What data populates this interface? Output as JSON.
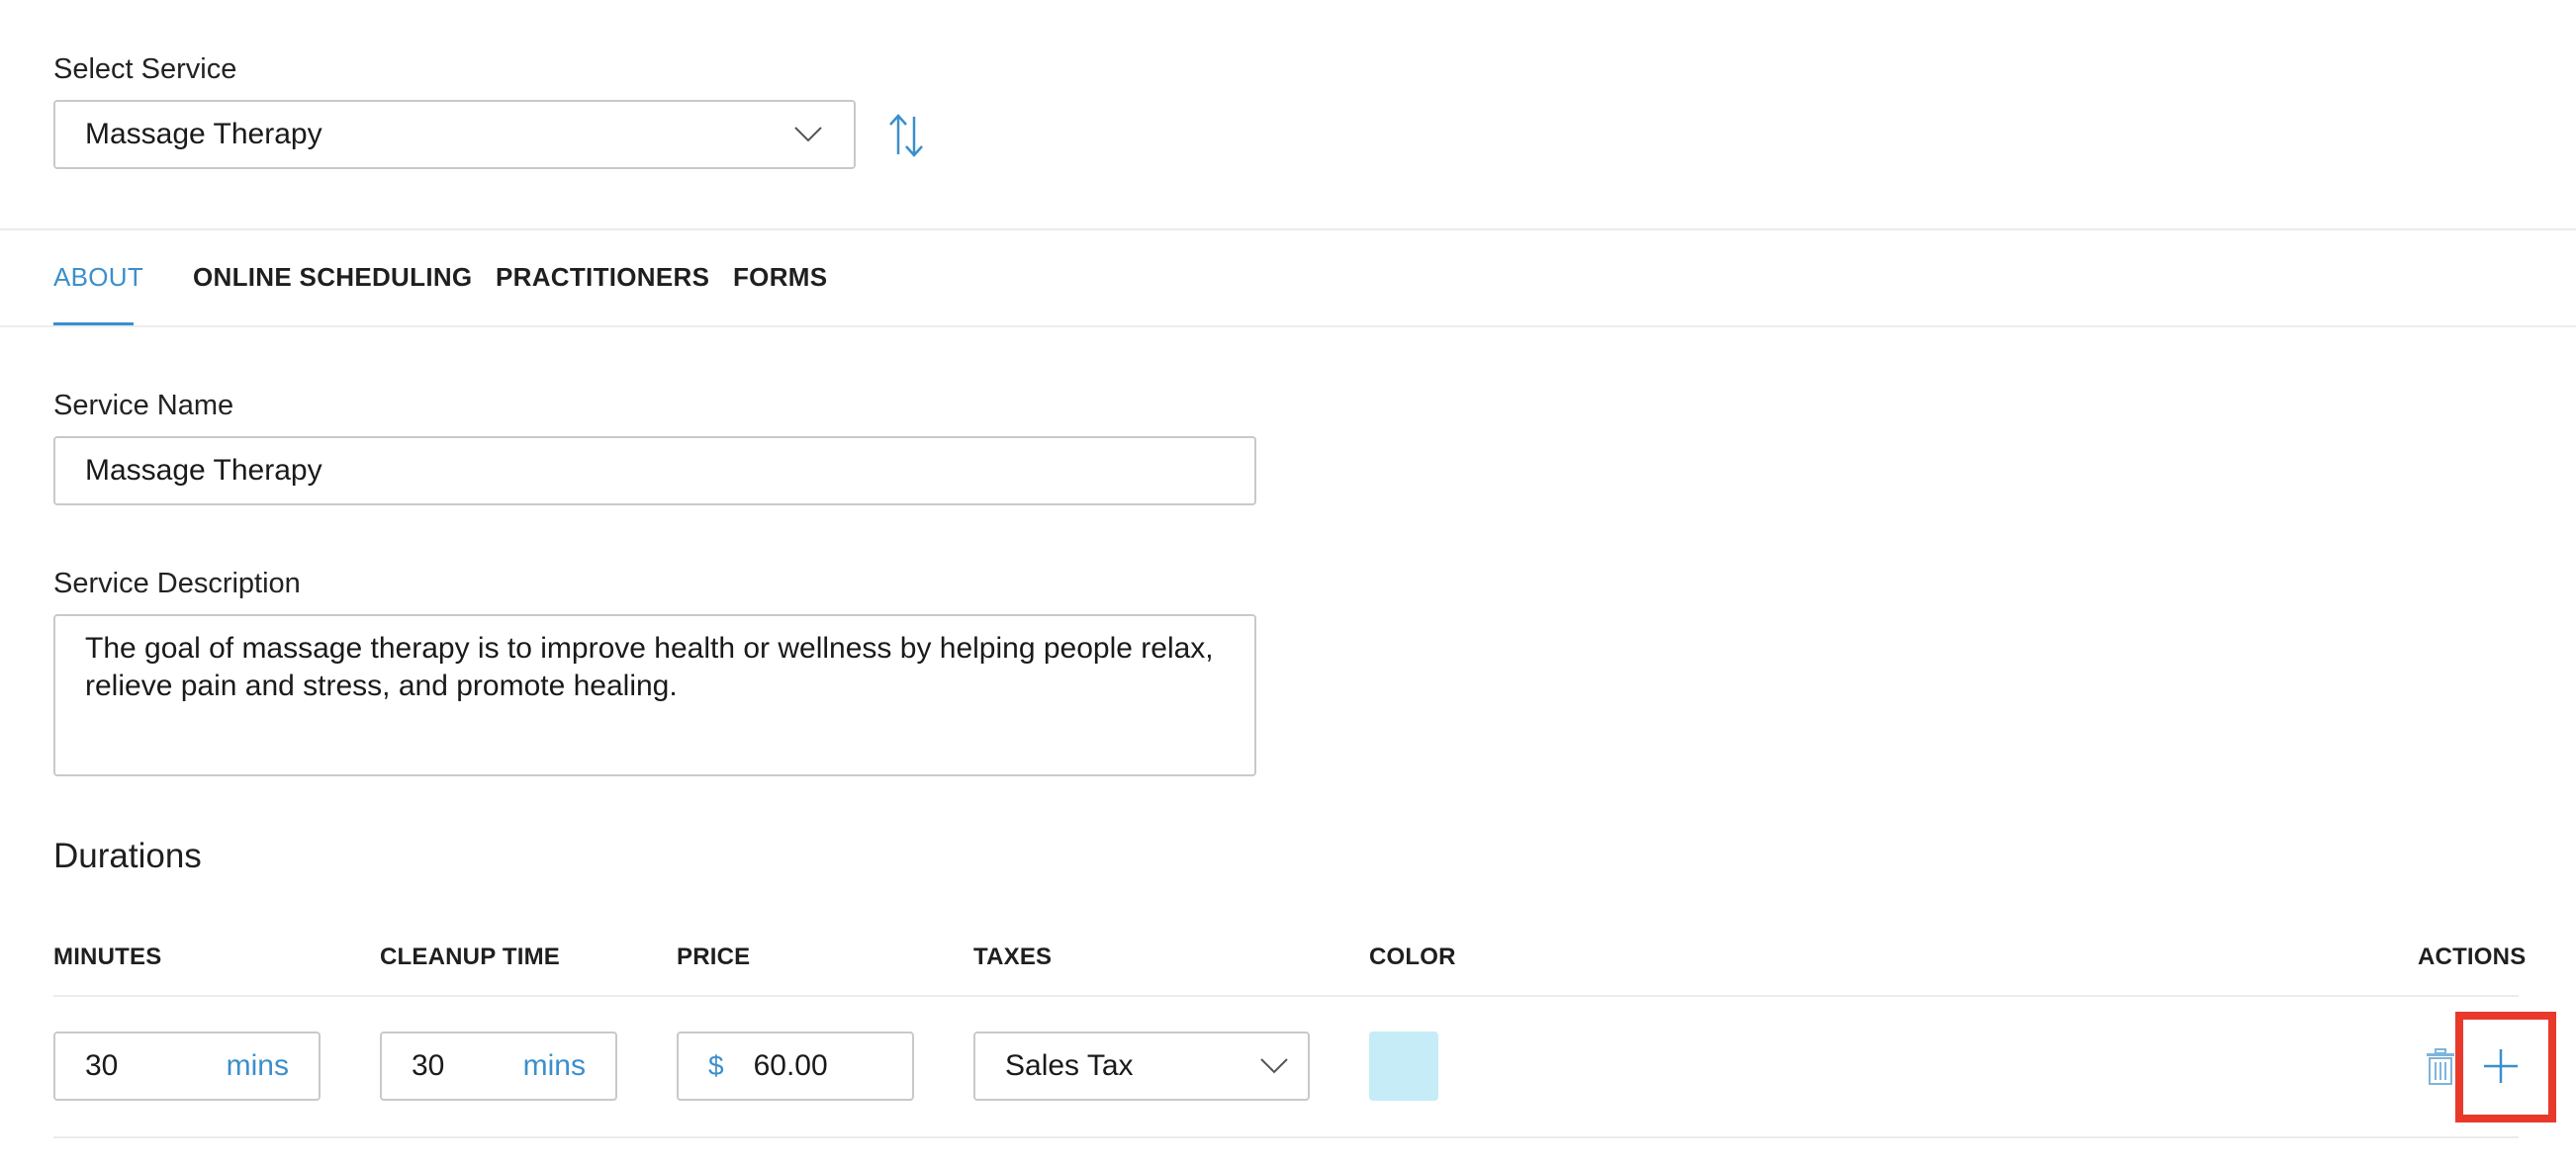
{
  "select_service": {
    "label": "Select Service",
    "value": "Massage Therapy"
  },
  "tabs": [
    {
      "label": "ABOUT",
      "active": true
    },
    {
      "label": "ONLINE SCHEDULING",
      "active": false
    },
    {
      "label": "PRACTITIONERS",
      "active": false
    },
    {
      "label": "FORMS",
      "active": false
    }
  ],
  "about": {
    "service_name_label": "Service Name",
    "service_name_value": "Massage Therapy",
    "description_label": "Service Description",
    "description_line1": "The goal of massage therapy is to improve health or wellness by helping people relax,",
    "description_line2": "relieve pain and stress, and promote healing."
  },
  "durations": {
    "title": "Durations",
    "columns": {
      "minutes": "MINUTES",
      "cleanup": "CLEANUP TIME",
      "price": "PRICE",
      "taxes": "TAXES",
      "color": "COLOR",
      "actions": "ACTIONS"
    },
    "rows": [
      {
        "minutes": "30",
        "minutes_unit": "mins",
        "cleanup": "30",
        "cleanup_unit": "mins",
        "currency": "$",
        "price": "60.00",
        "tax": "Sales Tax",
        "color": "#c5ecf7"
      }
    ]
  },
  "colors": {
    "accent": "#3b8fcc",
    "highlight": "#e8392b"
  }
}
